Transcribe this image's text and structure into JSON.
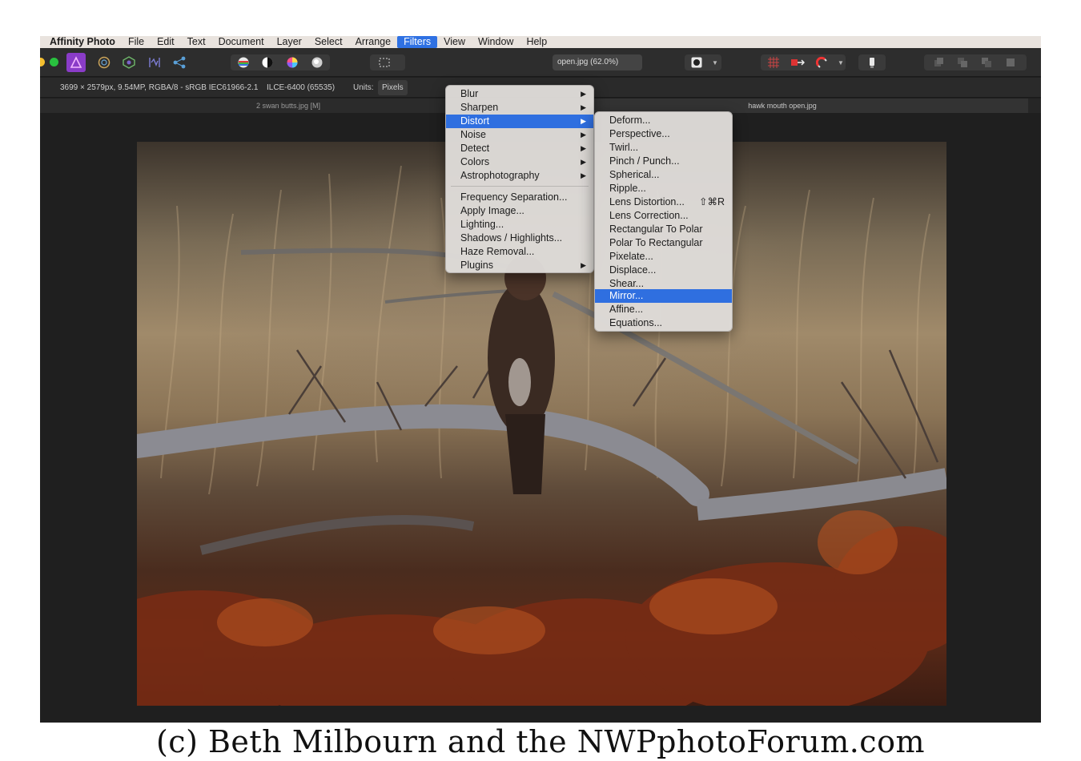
{
  "menubar": {
    "app_name": "Affinity Photo",
    "items": [
      "File",
      "Edit",
      "Text",
      "Document",
      "Layer",
      "Select",
      "Arrange",
      "Filters",
      "View",
      "Window",
      "Help"
    ]
  },
  "toolbar": {
    "document_name": "open.jpg (62.0%)",
    "icons": [
      "photo-persona-icon",
      "liquify-persona-icon",
      "develop-persona-icon",
      "tone-mapping-persona-icon",
      "export-persona-icon",
      "auto-levels-icon",
      "auto-contrast-icon",
      "auto-colors-icon",
      "auto-white-balance-icon",
      "marquee-icon",
      "quick-mask-icon",
      "snapping-icon",
      "assistant-icon",
      "arrange-icon"
    ]
  },
  "context_bar": {
    "image_info": "3699 × 2579px, 9.54MP, RGBA/8 - sRGB IEC61966-2.1",
    "camera": "ILCE-6400 (65535)",
    "units_label": "Units:",
    "units_value": "Pixels"
  },
  "tabs": [
    "2 swan butts.jpg [M]",
    "hawk mouth open.jpg"
  ],
  "filters_menu": {
    "groups": [
      [
        {
          "label": "Blur",
          "submenu": true
        },
        {
          "label": "Sharpen",
          "submenu": true
        },
        {
          "label": "Distort",
          "submenu": true,
          "highlighted": true
        },
        {
          "label": "Noise",
          "submenu": true
        },
        {
          "label": "Detect",
          "submenu": true
        },
        {
          "label": "Colors",
          "submenu": true
        },
        {
          "label": "Astrophotography",
          "submenu": true
        }
      ],
      [
        {
          "label": "Frequency Separation..."
        },
        {
          "label": "Apply Image..."
        },
        {
          "label": "Lighting..."
        },
        {
          "label": "Shadows / Highlights..."
        },
        {
          "label": "Haze Removal..."
        },
        {
          "label": "Plugins",
          "submenu": true
        }
      ]
    ]
  },
  "distort_menu": {
    "items": [
      {
        "label": "Deform..."
      },
      {
        "label": "Perspective..."
      },
      {
        "label": "Twirl..."
      },
      {
        "label": "Pinch / Punch..."
      },
      {
        "label": "Spherical..."
      },
      {
        "label": "Ripple..."
      },
      {
        "label": "Lens Distortion...",
        "shortcut": "⇧⌘R"
      },
      {
        "label": "Lens Correction..."
      },
      {
        "label": "Rectangular To Polar"
      },
      {
        "label": "Polar To Rectangular"
      },
      {
        "label": "Pixelate..."
      },
      {
        "label": "Displace..."
      },
      {
        "label": "Shear..."
      },
      {
        "label": "Mirror...",
        "highlighted": true
      },
      {
        "label": "Affine..."
      },
      {
        "label": "Equations..."
      }
    ]
  },
  "caption": "(c) Beth Milbourn and the NWPphotoForum.com",
  "colors": {
    "menu_highlight": "#2f6fe0",
    "toolbar_bg": "#2d2d2d",
    "canvas_bg": "#1f1f1f",
    "menu_bg": "#dedbd8"
  }
}
